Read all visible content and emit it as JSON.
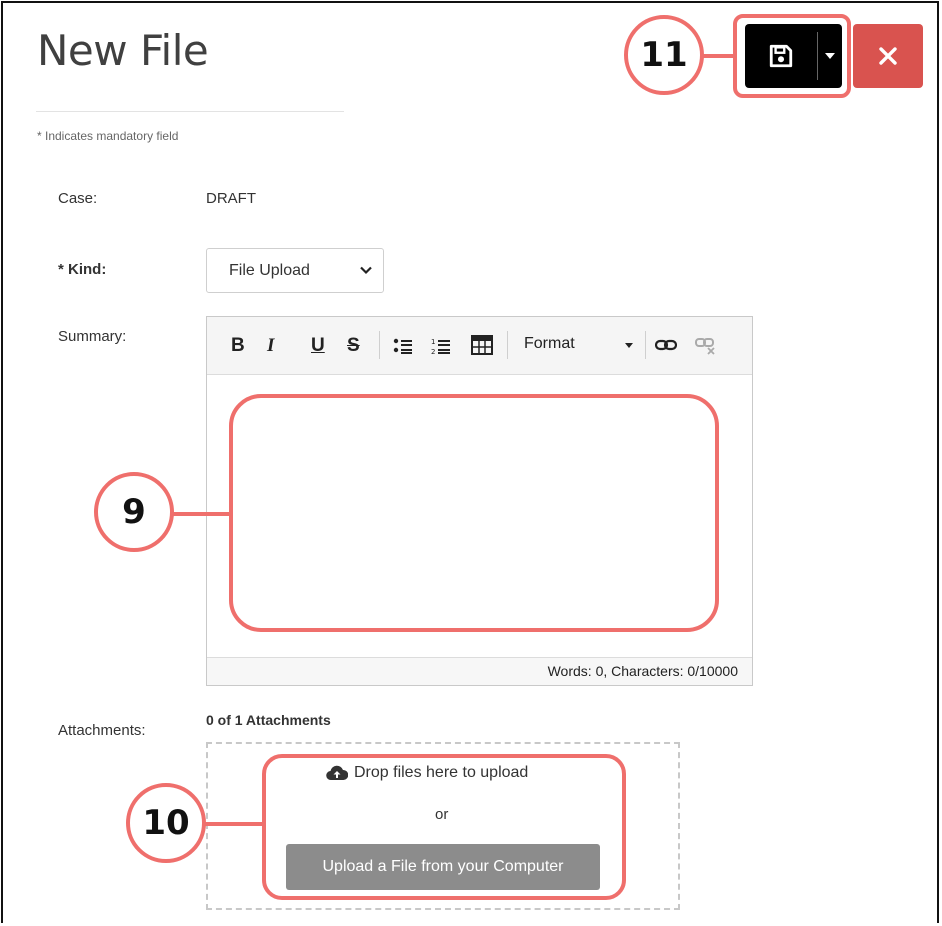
{
  "page": {
    "title": "New File",
    "mandatory_note": "* Indicates mandatory field"
  },
  "form": {
    "case_label": "Case:",
    "case_value": "DRAFT",
    "kind_label": "* Kind:",
    "kind_value": "File Upload",
    "summary_label": "Summary:",
    "attachments_label": "Attachments:"
  },
  "editor": {
    "toolbar": {
      "bold": "B",
      "italic": "I",
      "underline": "U",
      "strike": "S",
      "format": "Format"
    },
    "status": "Words: 0, Characters: 0/10000"
  },
  "attachments": {
    "count": "0 of 1 Attachments",
    "drop_text": "Drop files here to upload",
    "or_text": "or",
    "upload_button": "Upload a File from your Computer"
  },
  "callouts": {
    "save": "11",
    "summary": "9",
    "attachments": "10"
  },
  "colors": {
    "callout": "#ef6f6c",
    "close_button": "#d9534f",
    "save_button": "#000000",
    "upload_button": "#8c8c8c"
  }
}
